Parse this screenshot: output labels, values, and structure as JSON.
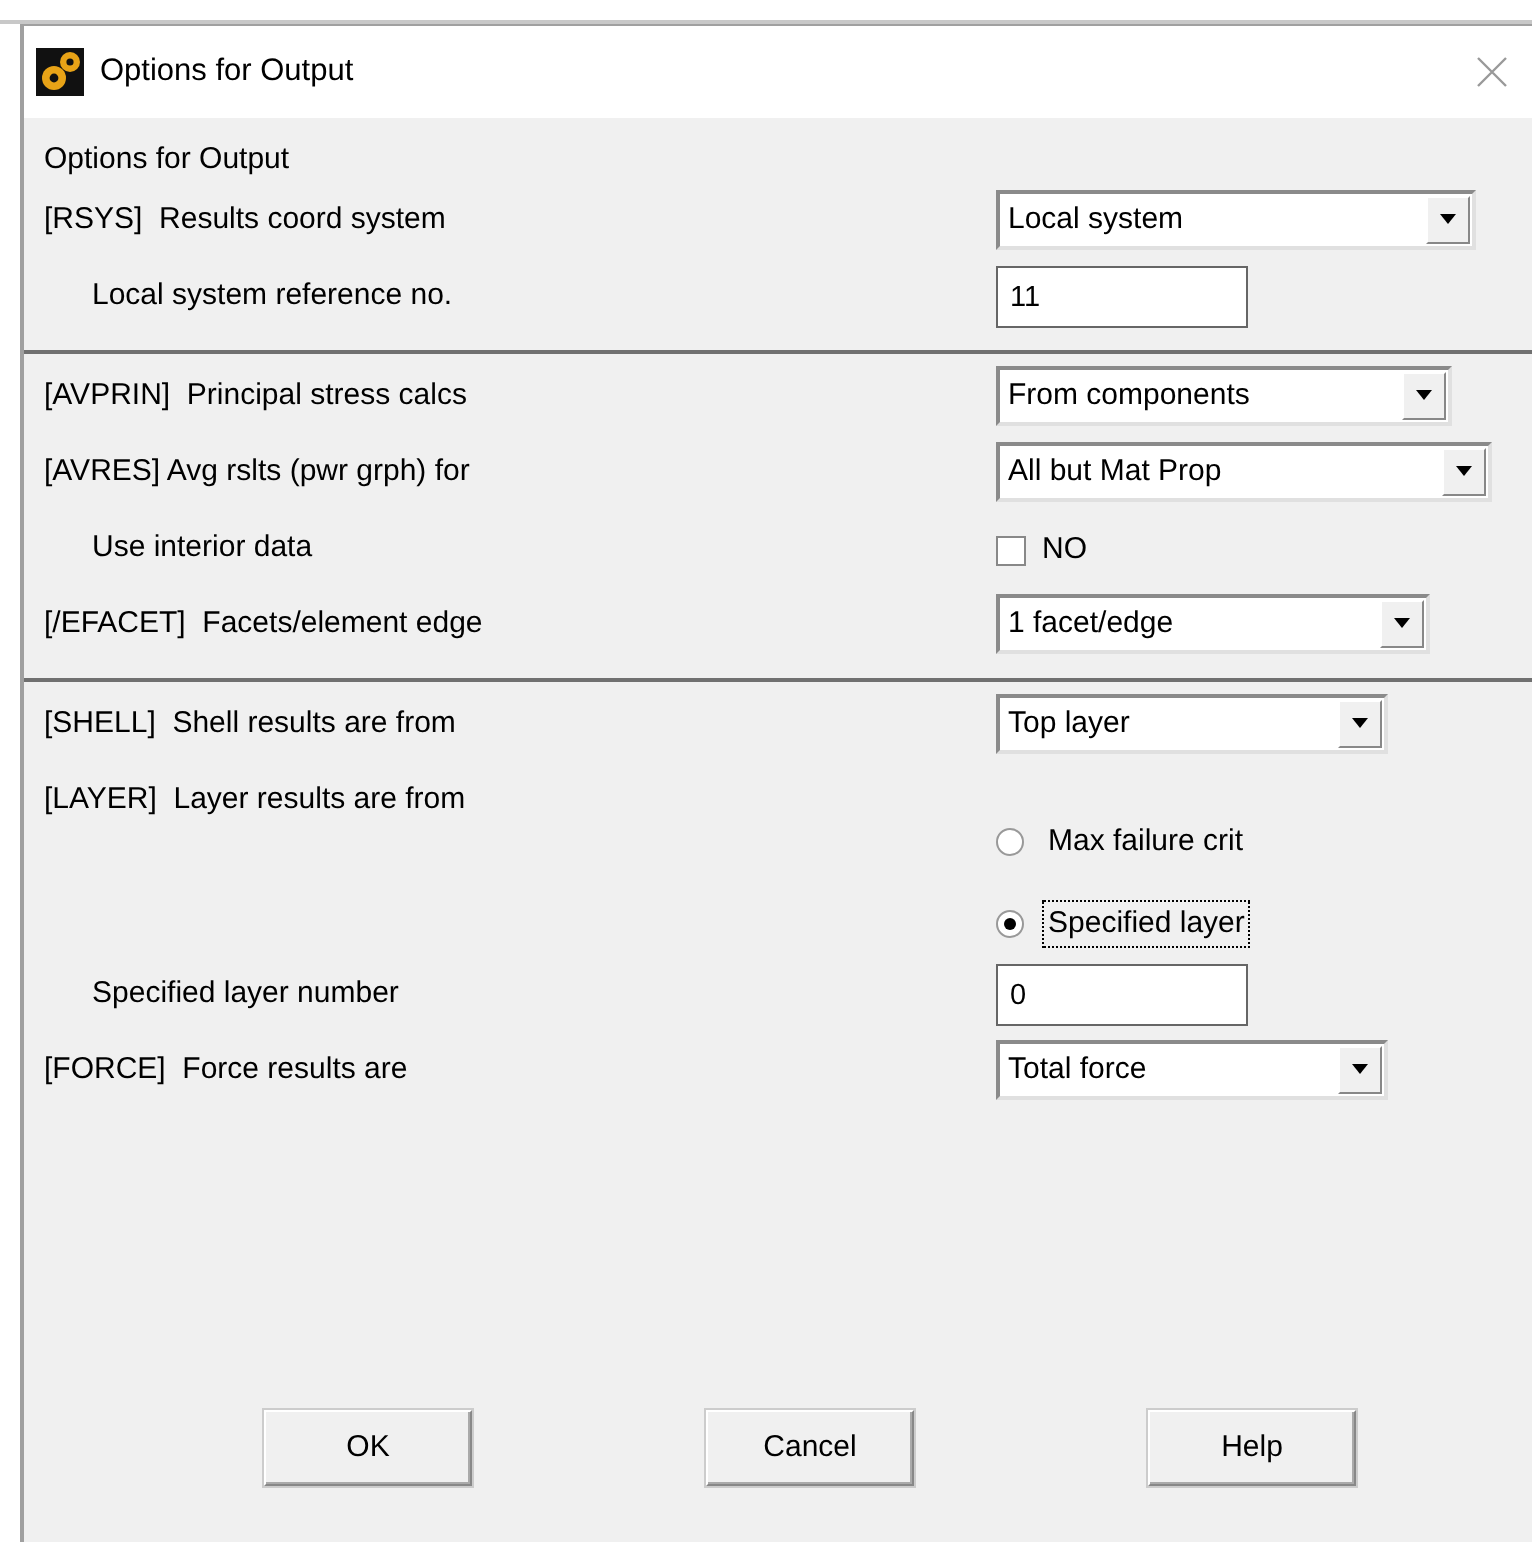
{
  "window": {
    "title": "Options for Output"
  },
  "heading": "Options for Output",
  "sections": [
    {
      "rows": [
        {
          "kind": "select",
          "label": "[RSYS]  Results coord system",
          "value": "Local system",
          "indented": false
        },
        {
          "kind": "input",
          "label": "Local system reference no.",
          "value": "11",
          "indented": true
        }
      ]
    },
    {
      "rows": [
        {
          "kind": "select",
          "label": "[AVPRIN]  Principal stress calcs",
          "value": "From components",
          "indented": false
        },
        {
          "kind": "select",
          "label": "[AVRES] Avg rslts (pwr grph) for",
          "value": "All but Mat Prop",
          "indented": false
        },
        {
          "kind": "checkbox",
          "label": "Use interior data",
          "text": "NO",
          "checked": false,
          "indented": true
        },
        {
          "kind": "select",
          "label": "[/EFACET]  Facets/element edge",
          "value": "1 facet/edge",
          "indented": false
        }
      ]
    },
    {
      "rows": [
        {
          "kind": "select",
          "label": "[SHELL]  Shell results are from",
          "value": "Top layer",
          "indented": false
        },
        {
          "kind": "radio",
          "label": "[LAYER]  Layer results are from",
          "indented": false,
          "options": [
            {
              "text": "Max failure crit",
              "selected": false,
              "focused": false
            },
            {
              "text": "Specified layer",
              "selected": true,
              "focused": true
            }
          ]
        },
        {
          "kind": "input",
          "label": "Specified layer number",
          "value": "0",
          "indented": true
        },
        {
          "kind": "select",
          "label": "[FORCE]  Force results are",
          "value": "Total force",
          "indented": false
        }
      ]
    }
  ],
  "buttons": [
    "OK",
    "Cancel",
    "Help"
  ]
}
